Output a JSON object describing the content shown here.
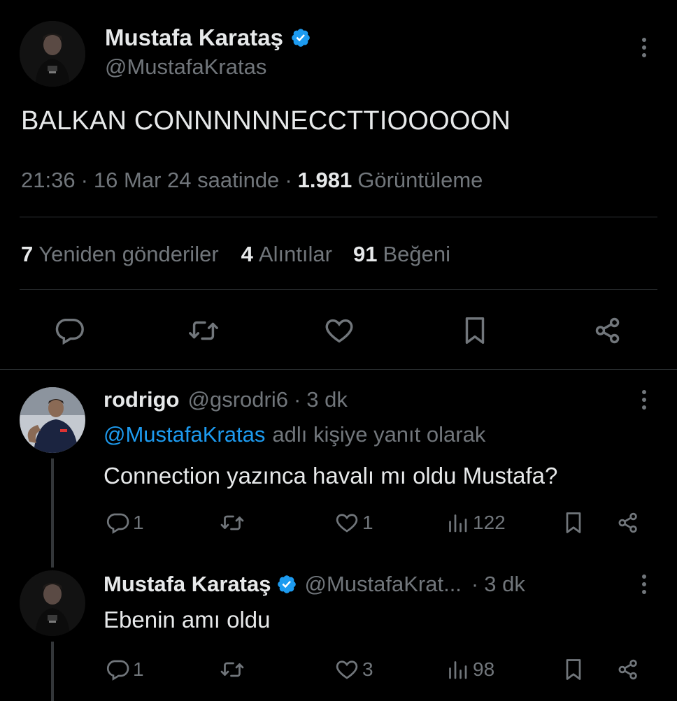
{
  "main_tweet": {
    "author_name": "Mustafa Karataş",
    "handle": "@MustafaKratas",
    "text": "BALKAN CONNNNNNECCTTIOOOOON",
    "time": "21:36",
    "date": "16 Mar 24 saatinde",
    "views_count": "1.981",
    "views_label": "Görüntüleme",
    "reposts_count": "7",
    "reposts_label": "Yeniden gönderiler",
    "quotes_count": "4",
    "quotes_label": "Alıntılar",
    "likes_count": "91",
    "likes_label": "Beğeni"
  },
  "replies": [
    {
      "author_name": "rodrigo",
      "handle": "@gsrodri6",
      "time": "3 dk",
      "reply_to_handle": "@MustafaKratas",
      "reply_to_suffix": "adlı kişiye yanıt olarak",
      "text": "Connection yazınca havalı mı oldu Mustafa?",
      "reply_count": "1",
      "retweet_count": "",
      "like_count": "1",
      "view_count": "122"
    },
    {
      "author_name": "Mustafa Karataş",
      "handle": "@MustafaKrat...",
      "time": "3 dk",
      "text": "Ebenin amı oldu",
      "reply_count": "1",
      "retweet_count": "",
      "like_count": "3",
      "view_count": "98"
    }
  ],
  "icons": {
    "verified": "verified-badge-icon",
    "more": "more-vertical-icon",
    "reply": "reply-icon",
    "retweet": "retweet-icon",
    "like": "heart-icon",
    "bookmark": "bookmark-icon",
    "share": "share-icon",
    "views": "views-icon"
  },
  "colors": {
    "background": "#000000",
    "text": "#e7e9ea",
    "muted": "#71767b",
    "accent": "#1d9bf0",
    "divider": "#2f3336"
  }
}
